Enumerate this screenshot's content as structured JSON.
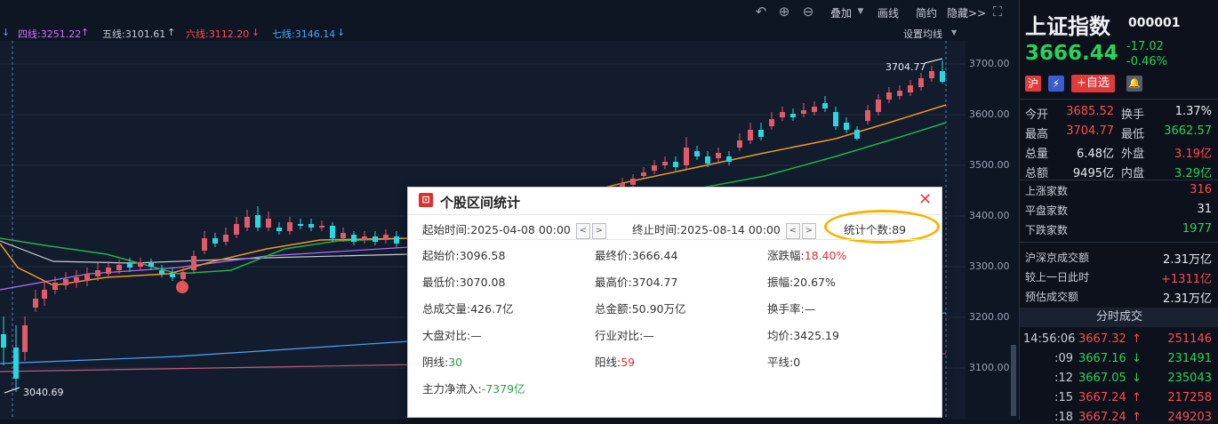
{
  "toolbar": {
    "overlay_label": "叠加",
    "draw_label": "画线",
    "simple_label": "简约",
    "hide_label": "隐藏>>"
  },
  "ma_bar": {
    "ma4": "四线:3251.22",
    "ma5": "五线:3101.61",
    "ma6": "六线:3112.20",
    "ma7": "七线:3146.14",
    "settings": "设置均线"
  },
  "chart": {
    "high_label": "3704.77",
    "low_label": "3040.69",
    "y_ticks": [
      "3700.00",
      "3600.00",
      "3500.00",
      "3400.00",
      "3300.00",
      "3200.00",
      "3100.00"
    ]
  },
  "quote": {
    "name": "上证指数",
    "code": "000001",
    "price": "3666.44",
    "change": "-17.02",
    "change_pct": "-0.46%",
    "tag_sh": "沪",
    "add_watch": "+自选"
  },
  "stats": [
    {
      "l1": "今开",
      "v1": "3685.52",
      "c1": "red",
      "l2": "换手",
      "v2": "1.37%",
      "c2": "white"
    },
    {
      "l1": "最高",
      "v1": "3704.77",
      "c1": "red",
      "l2": "最低",
      "v2": "3662.57",
      "c2": "green"
    },
    {
      "l1": "总量",
      "v1": "6.48亿",
      "c1": "white",
      "l2": "外盘",
      "v2": "3.19亿",
      "c2": "red"
    },
    {
      "l1": "总额",
      "v1": "9495亿",
      "c1": "white",
      "l2": "内盘",
      "v2": "3.29亿",
      "c2": "green"
    }
  ],
  "breadth": [
    {
      "label": "上涨家数",
      "value": "316",
      "color": "red"
    },
    {
      "label": "平盘家数",
      "value": "31",
      "color": "white"
    },
    {
      "label": "下跌家数",
      "value": "1977",
      "color": "green"
    }
  ],
  "turnover": [
    {
      "label": "沪深京成交额",
      "value": "2.31万亿",
      "color": "white"
    },
    {
      "label": "较上一日此时",
      "value": "+1311亿",
      "color": "red"
    },
    {
      "label": "预估成交额",
      "value": "2.31万亿",
      "color": "white"
    }
  ],
  "ticks_header": "分时成交",
  "ticks": [
    {
      "time": "14:56:06",
      "price": "3667.32",
      "dir": "up",
      "vol": "251146"
    },
    {
      "time": ":09",
      "price": "3667.16",
      "dir": "down",
      "vol": "231491"
    },
    {
      "time": ":12",
      "price": "3667.05",
      "dir": "down",
      "vol": "235043"
    },
    {
      "time": ":15",
      "price": "3667.24",
      "dir": "up",
      "vol": "217258"
    },
    {
      "time": ":18",
      "price": "3667.24",
      "dir": "up",
      "vol": "249203"
    }
  ],
  "dialog": {
    "title": "个股区间统计",
    "start_label": "起始时间:",
    "start_value": "2025-04-08  00:00",
    "end_label": "终止时间:",
    "end_value": "2025-08-14  00:00",
    "count_label": "统计个数:",
    "count_value": "89",
    "rows": [
      [
        {
          "k": "起始价:",
          "v": "3096.58",
          "c": ""
        },
        {
          "k": "最终价:",
          "v": "3666.44",
          "c": ""
        },
        {
          "k": "涨跌幅:",
          "v": "18.40%",
          "c": "red"
        }
      ],
      [
        {
          "k": "最低价:",
          "v": "3070.08",
          "c": ""
        },
        {
          "k": "最高价:",
          "v": "3704.77",
          "c": ""
        },
        {
          "k": "振幅:",
          "v": "20.67%",
          "c": ""
        }
      ],
      [
        {
          "k": "总成交量:",
          "v": "426.7亿",
          "c": ""
        },
        {
          "k": "总金额:",
          "v": "50.90万亿",
          "c": ""
        },
        {
          "k": "换手率:",
          "v": "—",
          "c": ""
        }
      ],
      [
        {
          "k": "大盘对比:",
          "v": "—",
          "c": ""
        },
        {
          "k": "行业对比:",
          "v": "—",
          "c": ""
        },
        {
          "k": "均价:",
          "v": "3425.19",
          "c": ""
        }
      ],
      [
        {
          "k": "阴线:",
          "v": "30",
          "c": "green"
        },
        {
          "k": "阳线:",
          "v": "59",
          "c": "red"
        },
        {
          "k": "平线:",
          "v": "0",
          "c": ""
        }
      ],
      [
        {
          "k": "主力净流入:",
          "v": "-7379亿",
          "c": "green"
        }
      ]
    ]
  }
}
